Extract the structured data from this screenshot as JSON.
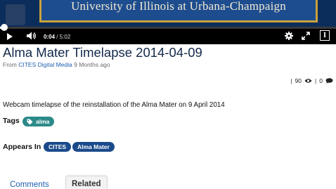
{
  "video": {
    "banner_text": "University of Illinois at Urbana-Champaign",
    "current_time": "0:04",
    "duration": "/ 5:02",
    "progress_fraction": 0.013
  },
  "media": {
    "title": "Alma Mater Timelapse 2014-04-09",
    "from_label": "From",
    "channel": "CITES Digital Media",
    "age": "9 Months ago",
    "views": "90",
    "comments_count": "0",
    "description": "Webcam timelapse of the reinstallation of the Alma Mater on 9 April 2014",
    "tags_label": "Tags",
    "tags": [
      "alma"
    ],
    "appears_label": "Appears In",
    "appears_in": [
      "CITES",
      "Alma Mater"
    ]
  },
  "tabs": {
    "comments": "Comments",
    "related": "Related"
  },
  "colors": {
    "accent": "#1b4a8b",
    "tag": "#2c8a89",
    "link": "#1f5fb0",
    "title": "#13294b"
  }
}
